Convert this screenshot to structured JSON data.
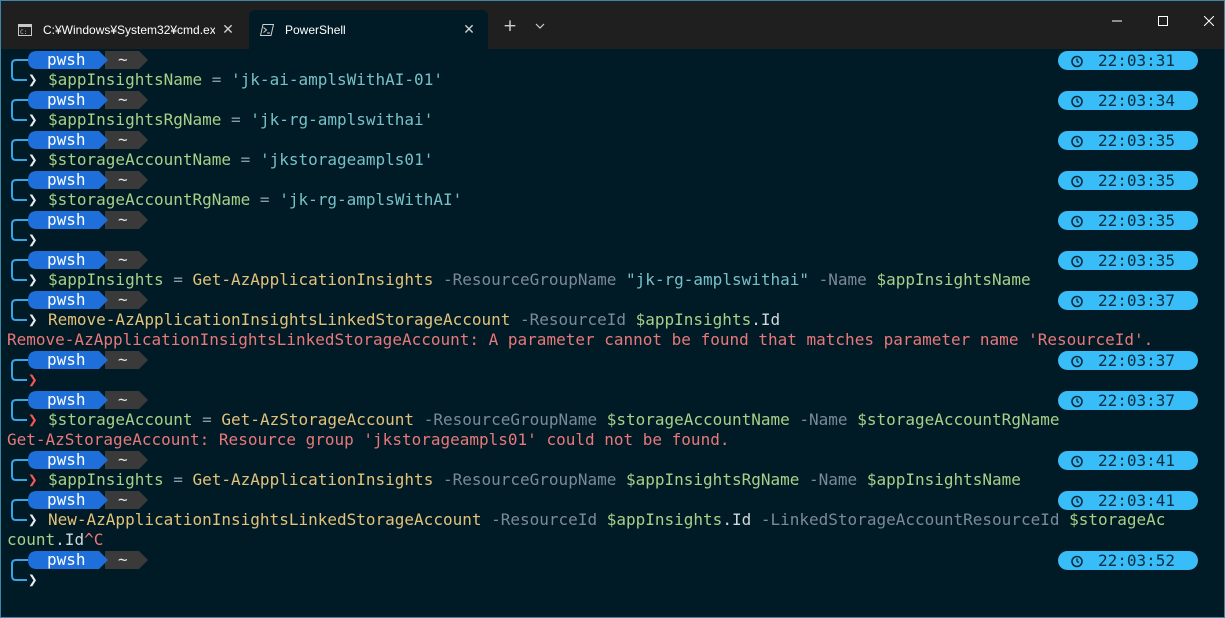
{
  "tabs": [
    {
      "label": "C:¥Windows¥System32¥cmd.ex",
      "icon": "cmd-icon",
      "active": false
    },
    {
      "label": "PowerShell",
      "icon": "powershell-icon",
      "active": true
    }
  ],
  "prompt": {
    "shell": "pwsh",
    "path": "~",
    "arrow": "❯",
    "clock_icon": "clock-icon"
  },
  "colors": {
    "pwsh_segment": "#1e6fd9",
    "path_segment": "#3a3a3a",
    "time_pill": "#38bdf8",
    "error": "#e8787a"
  },
  "times": [
    "22:03:31",
    "22:03:34",
    "22:03:35",
    "22:03:35",
    "22:03:35",
    "22:03:35",
    "22:03:37",
    "22:03:37",
    "22:03:37",
    "22:03:41",
    "22:03:41",
    "22:03:52"
  ],
  "commands": {
    "c1": {
      "var": "$appInsightsName",
      "op": " = ",
      "str": "'jk-ai-amplsWithAI-01'"
    },
    "c2": {
      "var": "$appInsightsRgName",
      "op": " = ",
      "str": "'jk-rg-amplswithai'"
    },
    "c3": {
      "var": "$storageAccountName",
      "op": " = ",
      "str": "'jkstorageampls01'"
    },
    "c4": {
      "var": "$storageAccountRgName",
      "op": " = ",
      "str": "'jk-rg-amplsWithAI'"
    },
    "c6": {
      "var": "$appInsights",
      "op": " = ",
      "cmd": "Get-AzApplicationInsights",
      "p1": " -ResourceGroupName ",
      "s1": "\"jk-rg-amplswithai\"",
      "p2": " -Name ",
      "v2": "$appInsightsName"
    },
    "c7": {
      "cmd": "Remove-AzApplicationInsightsLinkedStorageAccount",
      "p1": " -ResourceId ",
      "v1": "$appInsights",
      "prop": ".Id"
    },
    "c9": {
      "var": "$storageAccount",
      "op": " = ",
      "cmd": "Get-AzStorageAccount",
      "p1": " -ResourceGroupName ",
      "v1": "$storageAccountName",
      "p2": " -Name ",
      "v2": "$storageAccountRgName"
    },
    "c10": {
      "var": "$appInsights",
      "op": " = ",
      "cmd": "Get-AzApplicationInsights",
      "p1": " -ResourceGroupName ",
      "v1": "$appInsightsRgName",
      "p2": " -Name ",
      "v2": "$appInsightsName"
    },
    "c11": {
      "cmd": "New-AzApplicationInsightsLinkedStorageAccount",
      "p1": " -ResourceId ",
      "v1": "$appInsights",
      "prop1": ".Id",
      "p2": " -LinkedStorageAccountResourceId ",
      "v2": "$storageAc",
      "v2b": "count",
      "prop2": ".Id",
      "ctrl": "^C"
    }
  },
  "errors": {
    "e1": "Remove-AzApplicationInsightsLinkedStorageAccount: A parameter cannot be found that matches parameter name 'ResourceId'.",
    "e2": "Get-AzStorageAccount: Resource group 'jkstorageampls01' could not be found."
  }
}
